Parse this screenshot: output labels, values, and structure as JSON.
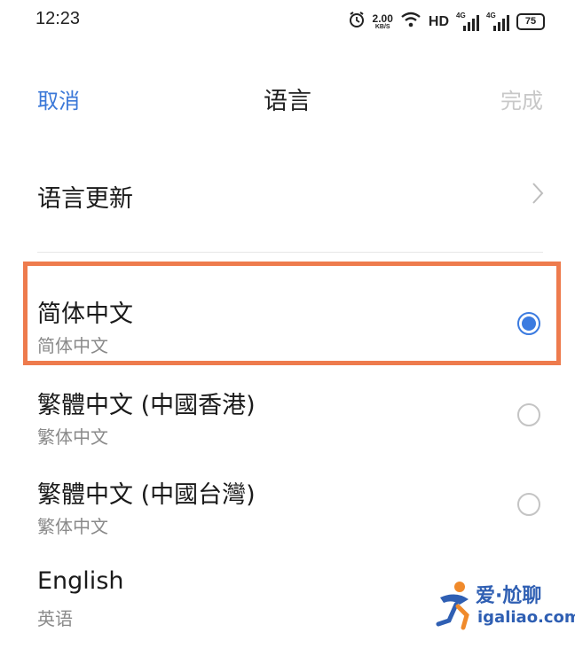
{
  "status_bar": {
    "time": "12:23",
    "net_speed": "2.00",
    "net_speed_unit": "KB/S",
    "hd": "HD",
    "signal1": "4G",
    "signal2": "4G",
    "battery": "75"
  },
  "nav": {
    "cancel": "取消",
    "title": "语言",
    "done": "完成"
  },
  "update": {
    "label": "语言更新"
  },
  "languages": [
    {
      "name": "简体中文",
      "sub": "简体中文",
      "selected": true
    },
    {
      "name": "繁體中文 (中國香港)",
      "sub": "繁体中文",
      "selected": false
    },
    {
      "name": "繁體中文 (中國台灣)",
      "sub": "繁体中文",
      "selected": false
    },
    {
      "name": "English",
      "sub": "英语",
      "selected": false
    }
  ],
  "watermark": {
    "top": "爱·尬聊",
    "bottom": "igaliao.com"
  },
  "colors": {
    "accent": "#3b7be0",
    "highlight_border": "#ee7b4d",
    "disabled": "#c8c8c8"
  }
}
